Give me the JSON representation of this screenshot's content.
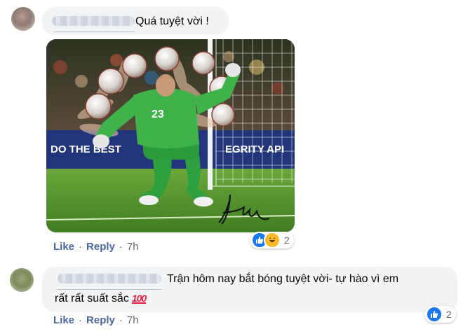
{
  "comments": [
    {
      "text": "Quá tuyệt vời !",
      "actions": {
        "like": "Like",
        "reply": "Reply",
        "separator": "·",
        "time": "7h"
      },
      "reactions": {
        "icons": [
          "like-icon",
          "haha-icon"
        ],
        "count": "2"
      }
    },
    {
      "text_line1": "Trận hôm nay bắt bóng tuyệt vời- tự hào vì em",
      "text_line2": "rất rất suất sắc",
      "emoji": "100",
      "actions": {
        "like": "Like",
        "reply": "Reply",
        "separator": "·",
        "time": "7h"
      },
      "reactions": {
        "icons": [
          "like-icon"
        ],
        "count": "2"
      }
    }
  ],
  "photo": {
    "jersey_number": "23",
    "banner_left": "DO THE BEST",
    "banner_right": "EGRITY API",
    "signature_icon": "signature"
  },
  "colors": {
    "bubble": "#f2f3f5",
    "link": "#4b66a0",
    "like": "#1877f2",
    "haha": "#f7b928",
    "pitch": "#5a9a2e",
    "jersey": "#3fb34a"
  }
}
